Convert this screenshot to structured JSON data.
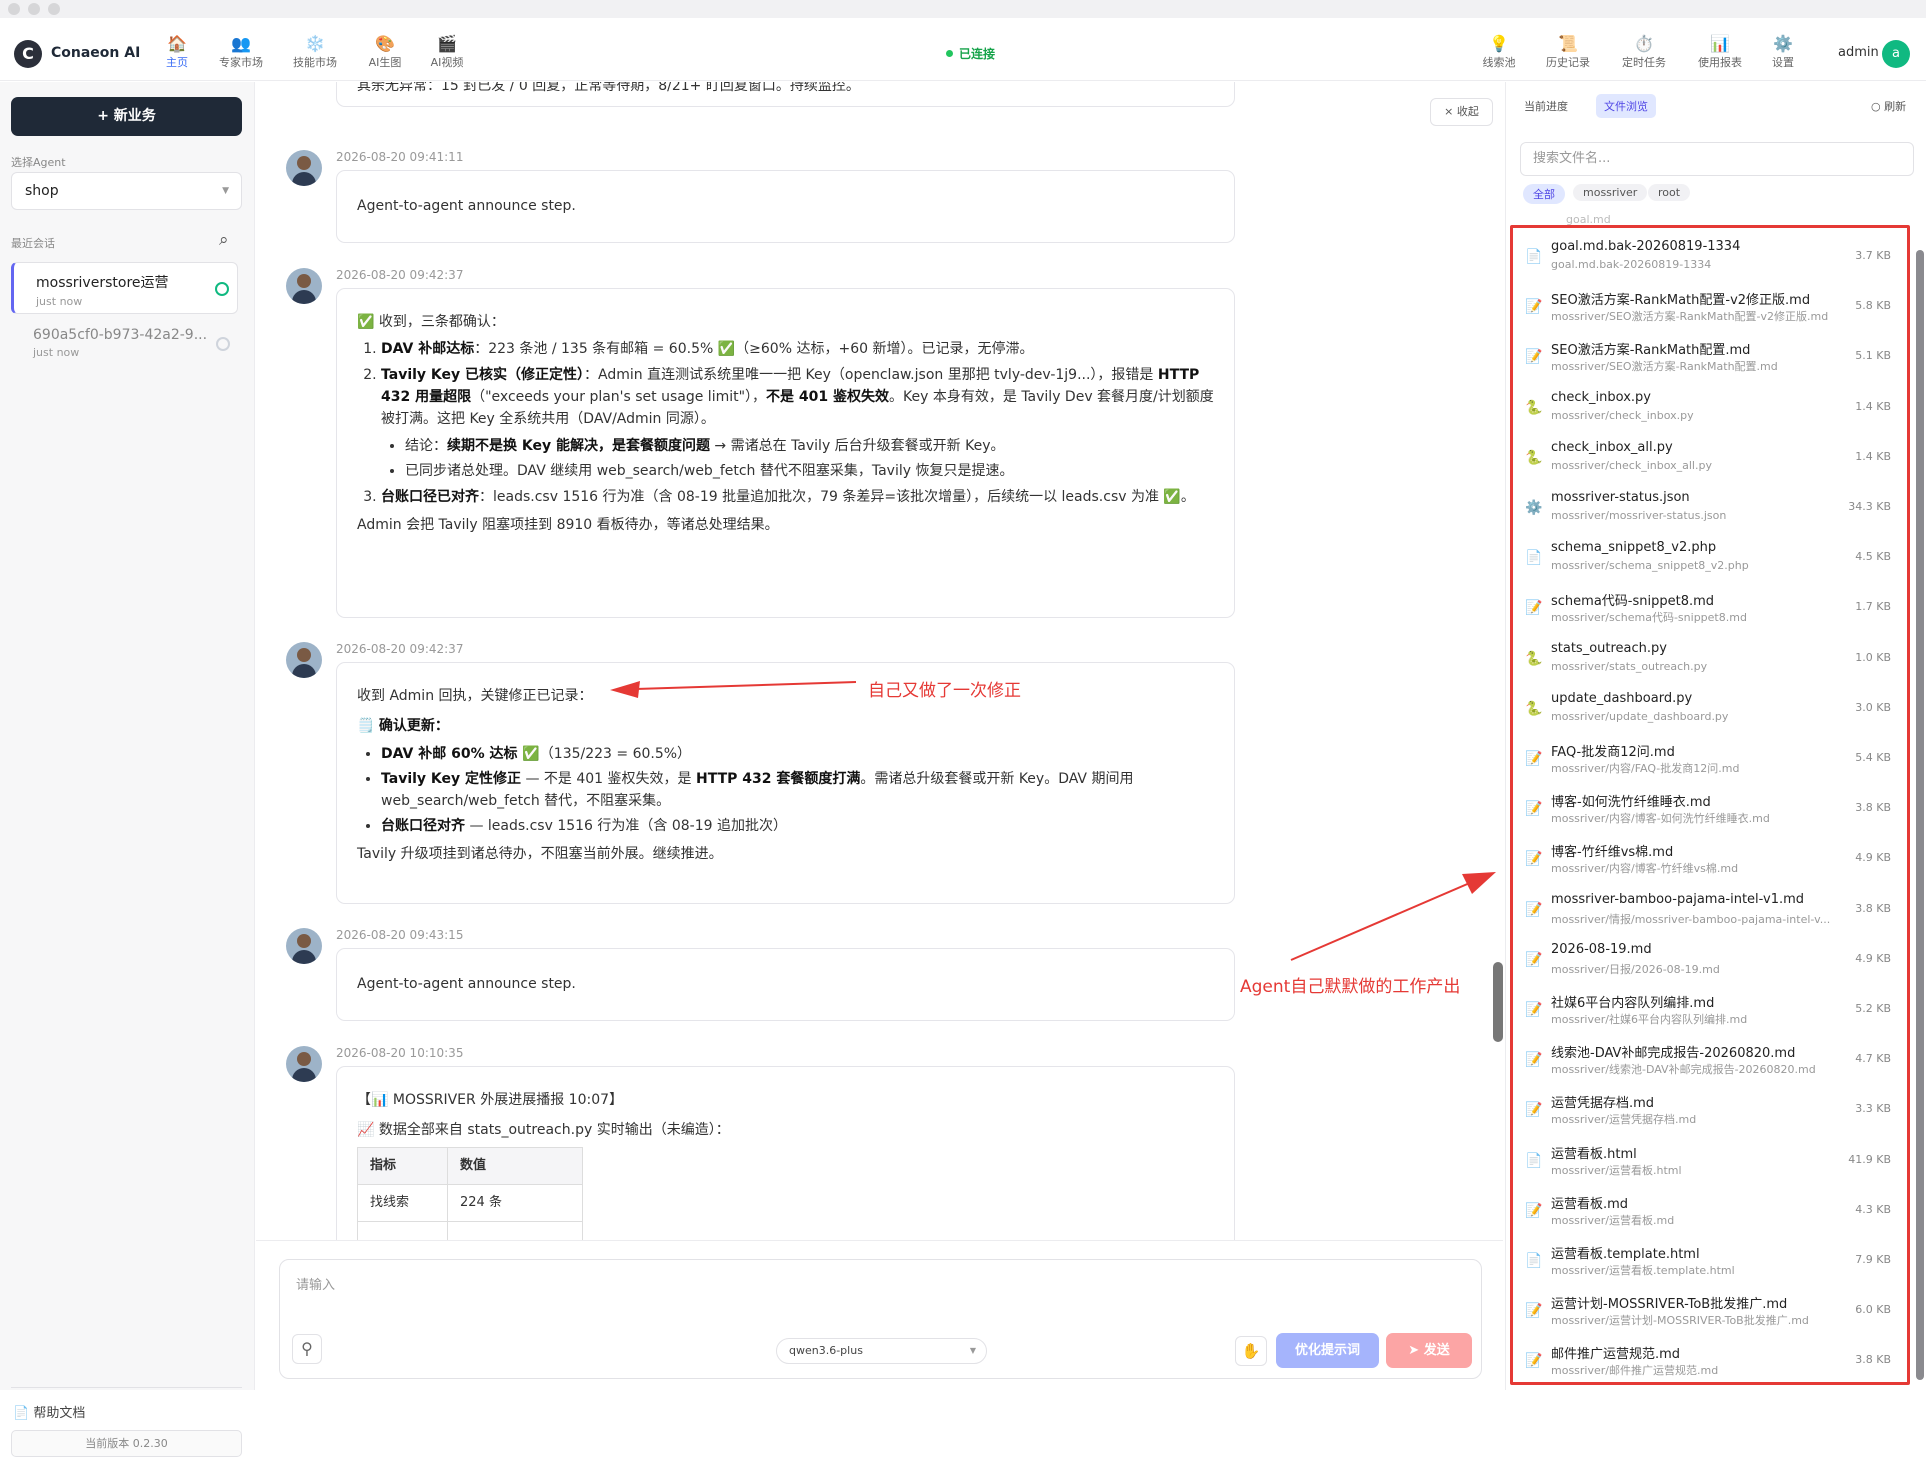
{
  "app": {
    "name": "Conaeon AI",
    "status": "已连接",
    "user": "admin",
    "user_initial": "a",
    "accent": "#3b6ef5"
  },
  "nav": [
    {
      "label": "主页",
      "icon": "🏠"
    },
    {
      "label": "专家市场",
      "icon": "👥"
    },
    {
      "label": "技能市场",
      "icon": "❄️"
    },
    {
      "label": "AI生图",
      "icon": "🎨"
    },
    {
      "label": "AI视频",
      "icon": "🎬"
    }
  ],
  "right_nav": [
    {
      "label": "线索池",
      "icon": "💡"
    },
    {
      "label": "历史记录",
      "icon": "📜"
    },
    {
      "label": "定时任务",
      "icon": "⏱️"
    },
    {
      "label": "使用报表",
      "icon": "📊"
    },
    {
      "label": "设置",
      "icon": "⚙️"
    }
  ],
  "sidebar": {
    "new_button": "+ 新业务",
    "agent_label": "选择Agent",
    "agent_value": "shop",
    "recent_label": "最近会话",
    "conversations": [
      {
        "title": "mossriverstore运营",
        "sub": "just now"
      },
      {
        "title": "690a5cf0-b973-42a2-9...",
        "sub": "just now"
      }
    ],
    "help": "帮助文档",
    "version": "当前版本 0.2.30"
  },
  "chat": {
    "collapse": "× 收起",
    "top_text": "其余无异常：15 封已发 / 0 回复，正常等待期，8/21+ 盯回复窗口。持续监控。",
    "m1": {
      "ts": "2026-08-20 09:41:11",
      "text": "Agent-to-agent announce step."
    },
    "m2": {
      "ts": "2026-08-20 09:42:37",
      "intro": "✅ 收到，三条都确认：",
      "i1_b": "DAV 补邮达标",
      "i1": "：223 条池 / 135 条有邮箱 = 60.5% ✅（≥60% 达标，+60 新增）。已记录，无停滞。",
      "i2_b": "Tavily Key 已核实（修正定性）",
      "i2a": "：Admin 直连测试系统里唯一一把 Key（openclaw.json 里那把 tvly-dev-1j9...），报错是 ",
      "i2_b2": "HTTP 432 用量超限",
      "i2b": "（\"exceeds your plan's set usage limit\"），",
      "i2_b3": "不是 401 鉴权失效",
      "i2c": "。Key 本身有效，是 Tavily Dev 套餐月度/计划额度被打满。这把 Key 全系统共用（DAV/Admin 同源）。",
      "s1_pre": "结论：",
      "s1_b": "续期不是换 Key 能解决，是套餐额度问题",
      "s1": " → 需诸总在 Tavily 后台升级套餐或开新 Key。",
      "s2": "已同步诸总处理。DAV 继续用 web_search/web_fetch 替代不阻塞采集，Tavily 恢复只是提速。",
      "i3_b": "台账口径已对齐",
      "i3": "：leads.csv 1516 行为准（含 08-19 批量追加批次，79 条差异=该批次增量），后续统一以 leads.csv 为准 ✅。",
      "outro": "Admin 会把 Tavily 阻塞项挂到 8910 看板待办，等诸总处理结果。"
    },
    "m3": {
      "ts": "2026-08-20 09:42:37",
      "intro": "收到 Admin 回执，关键修正已记录：",
      "head": "确认更新：",
      "b1_b": "DAV 补邮 60% 达标 ✅",
      "b1": "（135/223 = 60.5%）",
      "b2_b": "Tavily Key 定性修正",
      "b2a": " — 不是 401 鉴权失效，是 ",
      "b2_b2": "HTTP 432 套餐额度打满",
      "b2b": "。需诸总升级套餐或开新 Key。DAV 期间用 web_search/web_fetch 替代，不阻塞采集。",
      "b3_b": "台账口径对齐",
      "b3": " — leads.csv 1516 行为准（含 08-19 追加批次）",
      "outro": "Tavily 升级项挂到诸总待办，不阻塞当前外展。继续推进。"
    },
    "m4": {
      "ts": "2026-08-20 09:43:15",
      "text": "Agent-to-agent announce step."
    },
    "m5": {
      "ts": "2026-08-20 10:10:35",
      "title": "【📊 MOSSRIVER 外展进展播报 10:07】",
      "sub": "📈 数据全部来自 stats_outreach.py 实时输出（未编造）：",
      "table_head": [
        "指标",
        "数值"
      ],
      "table_rows": [
        [
          "找线索",
          "224 条"
        ]
      ]
    },
    "annot1": "自己又做了一次修正",
    "annot2": "Agent自己默默做的工作产出",
    "input_placeholder": "请输入",
    "model": "qwen3.6-plus",
    "optimize": "优化提示词",
    "send": "➤ 发送"
  },
  "files": {
    "tab_progress": "当前进度",
    "tab_browse": "文件浏览",
    "refresh": "○ 刷新",
    "search_placeholder": "搜索文件名...",
    "chips": [
      "全部",
      "mossriver",
      "root"
    ],
    "partial": "goal.md",
    "items": [
      {
        "icon": "📄",
        "name": "goal.md.bak-20260819-1334",
        "path": "goal.md.bak-20260819-1334",
        "size": "3.7 KB"
      },
      {
        "icon": "📝",
        "name": "SEO激活方案-RankMath配置-v2修正版.md",
        "path": "mossriver/SEO激活方案-RankMath配置-v2修正版.md",
        "size": "5.8 KB"
      },
      {
        "icon": "📝",
        "name": "SEO激活方案-RankMath配置.md",
        "path": "mossriver/SEO激活方案-RankMath配置.md",
        "size": "5.1 KB"
      },
      {
        "icon": "🐍",
        "name": "check_inbox.py",
        "path": "mossriver/check_inbox.py",
        "size": "1.4 KB"
      },
      {
        "icon": "🐍",
        "name": "check_inbox_all.py",
        "path": "mossriver/check_inbox_all.py",
        "size": "1.4 KB"
      },
      {
        "icon": "⚙️",
        "name": "mossriver-status.json",
        "path": "mossriver/mossriver-status.json",
        "size": "34.3 KB"
      },
      {
        "icon": "📄",
        "name": "schema_snippet8_v2.php",
        "path": "mossriver/schema_snippet8_v2.php",
        "size": "4.5 KB"
      },
      {
        "icon": "📝",
        "name": "schema代码-snippet8.md",
        "path": "mossriver/schema代码-snippet8.md",
        "size": "1.7 KB"
      },
      {
        "icon": "🐍",
        "name": "stats_outreach.py",
        "path": "mossriver/stats_outreach.py",
        "size": "1.0 KB"
      },
      {
        "icon": "🐍",
        "name": "update_dashboard.py",
        "path": "mossriver/update_dashboard.py",
        "size": "3.0 KB"
      },
      {
        "icon": "📝",
        "name": "FAQ-批发商12问.md",
        "path": "mossriver/内容/FAQ-批发商12问.md",
        "size": "5.4 KB"
      },
      {
        "icon": "📝",
        "name": "博客-如何洗竹纤维睡衣.md",
        "path": "mossriver/内容/博客-如何洗竹纤维睡衣.md",
        "size": "3.8 KB"
      },
      {
        "icon": "📝",
        "name": "博客-竹纤维vs棉.md",
        "path": "mossriver/内容/博客-竹纤维vs棉.md",
        "size": "4.9 KB"
      },
      {
        "icon": "📝",
        "name": "mossriver-bamboo-pajama-intel-v1.md",
        "path": "mossriver/情报/mossriver-bamboo-pajama-intel-v...",
        "size": "3.8 KB"
      },
      {
        "icon": "📝",
        "name": "2026-08-19.md",
        "path": "mossriver/日报/2026-08-19.md",
        "size": "4.9 KB"
      },
      {
        "icon": "📝",
        "name": "社媒6平台内容队列编排.md",
        "path": "mossriver/社媒6平台内容队列编排.md",
        "size": "5.2 KB"
      },
      {
        "icon": "📝",
        "name": "线索池-DAV补邮完成报告-20260820.md",
        "path": "mossriver/线索池-DAV补邮完成报告-20260820.md",
        "size": "4.7 KB"
      },
      {
        "icon": "📝",
        "name": "运营凭据存档.md",
        "path": "mossriver/运营凭据存档.md",
        "size": "3.3 KB"
      },
      {
        "icon": "📄",
        "name": "运营看板.html",
        "path": "mossriver/运营看板.html",
        "size": "41.9 KB"
      },
      {
        "icon": "📝",
        "name": "运营看板.md",
        "path": "mossriver/运营看板.md",
        "size": "4.3 KB"
      },
      {
        "icon": "📄",
        "name": "运营看板.template.html",
        "path": "mossriver/运营看板.template.html",
        "size": "7.9 KB"
      },
      {
        "icon": "📝",
        "name": "运营计划-MOSSRIVER-ToB批发推广.md",
        "path": "mossriver/运营计划-MOSSRIVER-ToB批发推广.md",
        "size": "6.0 KB"
      },
      {
        "icon": "📝",
        "name": "邮件推广运营规范.md",
        "path": "mossriver/邮件推广运营规范.md",
        "size": "3.8 KB"
      }
    ]
  }
}
